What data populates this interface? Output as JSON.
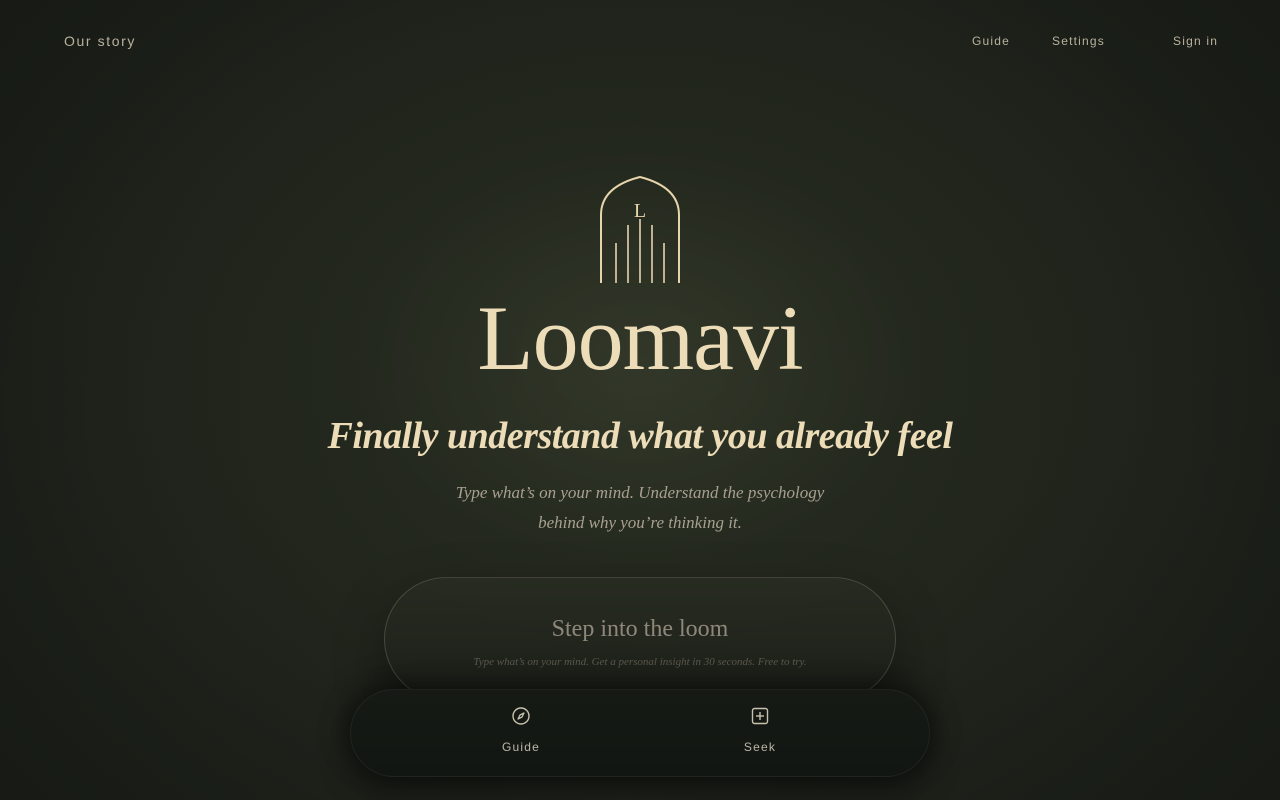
{
  "nav": {
    "left_link": "Our story",
    "guide": "Guide",
    "settings": "Settings",
    "sign_in": "Sign in"
  },
  "hero": {
    "logo_letter": "L",
    "brand": "Loomavi",
    "tagline": "Finally understand what you already feel",
    "subtext_line1": "Type what’s on your mind. Understand the psychology",
    "subtext_line2": "behind why you’re thinking it."
  },
  "cta": {
    "title": "Step into the loom",
    "subtitle": "Type what’s on your mind. Get a personal insight in 30 seconds. Free to try."
  },
  "dock": {
    "items": [
      {
        "label": "Guide",
        "icon": "compass-icon"
      },
      {
        "label": "Seek",
        "icon": "plus-square-icon"
      }
    ]
  },
  "colors": {
    "background": "#1b1f17",
    "accent_cream": "#ecdcb7",
    "muted_text": "#a8a090"
  }
}
